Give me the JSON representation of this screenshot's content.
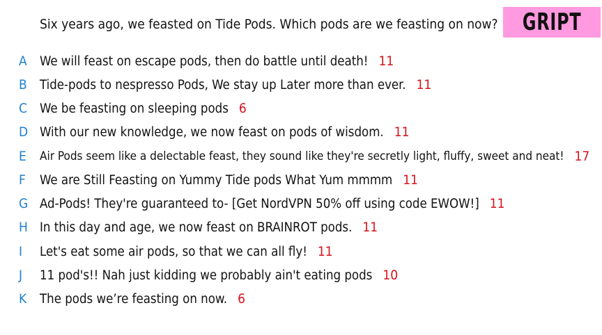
{
  "question": "Six years ago, we feasted on Tide Pods. Which pods are we feasting on now?",
  "logo": {
    "text": "GRIPT",
    "bg": "#ff99e0"
  },
  "colors": {
    "letter": "#1f7fd0",
    "score": "#d6121a",
    "text": "#111111"
  },
  "answers": [
    {
      "letter": "A",
      "text": "We will feast on escape pods, then do battle until death!",
      "score": "11"
    },
    {
      "letter": "B",
      "text": "Tide-pods to nespresso Pods, We stay up Later more than ever.",
      "score": "11"
    },
    {
      "letter": "C",
      "text": "We be feasting on sleeping pods",
      "score": "6"
    },
    {
      "letter": "D",
      "text": "With our new knowledge, we now feast on pods of wisdom.",
      "score": "11"
    },
    {
      "letter": "E",
      "text": "Air Pods seem like a delectable feast, they sound like they're secretly light, fluffy, sweet and neat!",
      "score": "17"
    },
    {
      "letter": "F",
      "text": "We are Still Feasting on Yummy Tide pods What Yum mmmm",
      "score": "11"
    },
    {
      "letter": "G",
      "text": "Ad-Pods! They're guaranteed to- [Get NordVPN 50% off using code EWOW!]",
      "score": "11"
    },
    {
      "letter": "H",
      "text": "In this day and age, we now feast on BRAINROT pods.",
      "score": "11"
    },
    {
      "letter": "I",
      "text": "Let's eat some air pods, so that we can all fly!",
      "score": "11"
    },
    {
      "letter": "J",
      "text": "11 pod's!! Nah just kidding we probably ain't eating pods",
      "score": "10"
    },
    {
      "letter": "K",
      "text": "The pods we’re feasting on now.",
      "score": "6"
    }
  ]
}
